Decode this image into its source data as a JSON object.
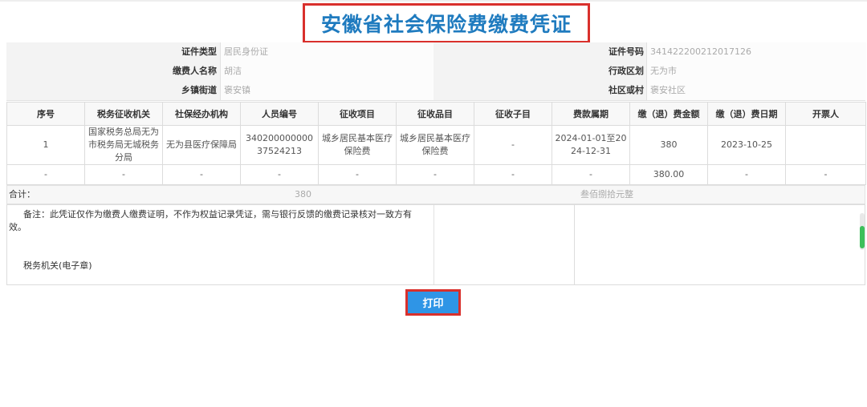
{
  "header": {
    "title": "安徽省社会保险费缴费凭证"
  },
  "info": {
    "id_type_label": "证件类型",
    "id_type_value": "居民身份证",
    "id_no_label": "证件号码",
    "id_no_value": "341422200212017126",
    "payer_label": "缴费人名称",
    "payer_value": "胡洁",
    "region_label": "行政区划",
    "region_value": "无为市",
    "town_label": "乡镇街道",
    "town_value": "褒安镇",
    "community_label": "社区或村",
    "community_value": "褒安社区"
  },
  "table": {
    "headers": [
      "序号",
      "税务征收机关",
      "社保经办机构",
      "人员编号",
      "征收项目",
      "征收品目",
      "征收子目",
      "费款属期",
      "缴（退）费金额",
      "缴（退）费日期",
      "开票人"
    ],
    "row1": [
      "1",
      "国家税务总局无为市税务局无城税务分局",
      "无为县医疗保障局",
      "34020000000037524213",
      "城乡居民基本医疗保险费",
      "城乡居民基本医疗保险费",
      "-",
      "2024-01-01至2024-12-31",
      "380",
      "2023-10-25",
      ""
    ],
    "row2": [
      "-",
      "-",
      "-",
      "-",
      "-",
      "-",
      "-",
      "-",
      "380.00",
      "-",
      "-"
    ]
  },
  "summary": {
    "label": "合计：",
    "amount": "380",
    "amount_words": "叁佰捌拾元整"
  },
  "remark": {
    "text": "备注：此凭证仅作为缴费人缴费证明，不作为权益记录凭证，需与银行反馈的缴费记录核对一致方有效。",
    "seal": "税务机关(电子章)"
  },
  "actions": {
    "print_label": "打印"
  },
  "colors": {
    "accent": "#d9302c",
    "title": "#1f7bbf",
    "button": "#2f95e6",
    "scroll_thumb": "#3dbf5a"
  }
}
